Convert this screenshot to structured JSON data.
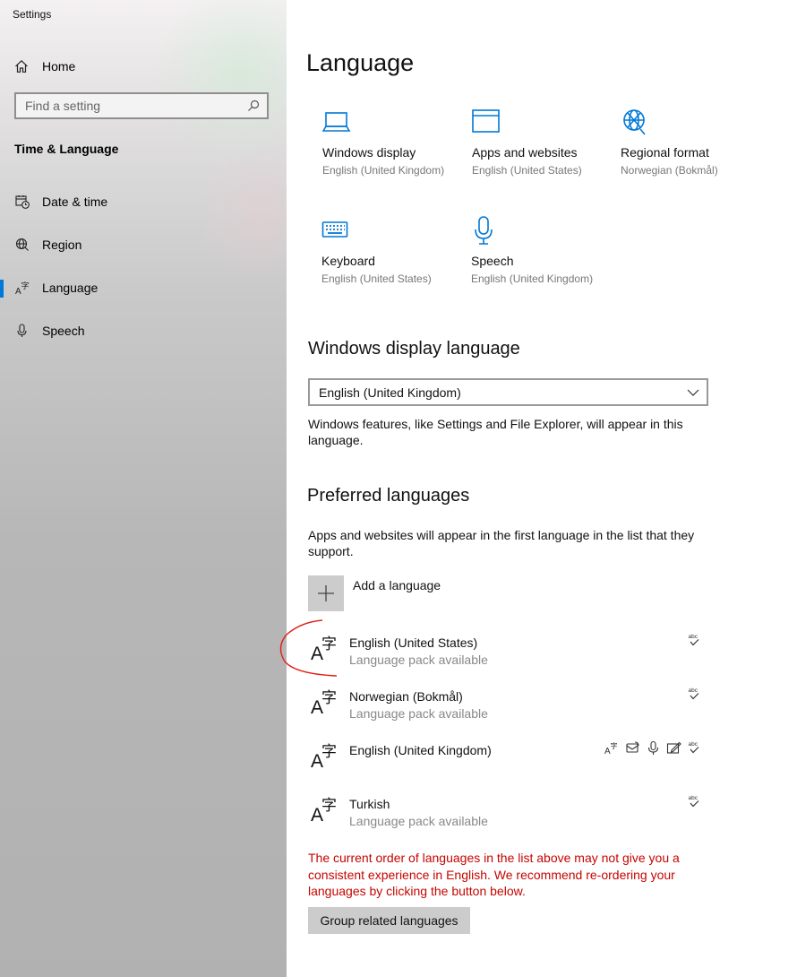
{
  "window": {
    "title": "Settings"
  },
  "sidebar": {
    "home_label": "Home",
    "search_placeholder": "Find a setting",
    "section_title": "Time & Language",
    "items": [
      {
        "label": "Date & time",
        "icon": "calendar-clock-icon",
        "active": false
      },
      {
        "label": "Region",
        "icon": "globe-region-icon",
        "active": false
      },
      {
        "label": "Language",
        "icon": "language-icon",
        "active": true
      },
      {
        "label": "Speech",
        "icon": "microphone-icon",
        "active": false
      }
    ],
    "accent_color": "#0078d7"
  },
  "main": {
    "title": "Language",
    "tiles": [
      {
        "name": "Windows display",
        "sub": "English (United Kingdom)",
        "icon": "laptop-icon"
      },
      {
        "name": "Apps and websites",
        "sub": "English (United States)",
        "icon": "browser-window-icon"
      },
      {
        "name": "Regional format",
        "sub": "Norwegian (Bokmål)",
        "icon": "globe-format-icon"
      },
      {
        "name": "Keyboard",
        "sub": "English (United States)",
        "icon": "keyboard-icon"
      },
      {
        "name": "Speech",
        "sub": "English (United Kingdom)",
        "icon": "microphone-icon"
      }
    ],
    "display_language": {
      "heading": "Windows display language",
      "selected": "English (United Kingdom)",
      "description": "Windows features, like Settings and File Explorer, will appear in this language."
    },
    "preferred": {
      "heading": "Preferred languages",
      "description": "Apps and websites will appear in the first language in the list that they support.",
      "add_label": "Add a language",
      "languages": [
        {
          "name": "English (United States)",
          "status": "Language pack available",
          "features": [
            "spellcheck-icon"
          ]
        },
        {
          "name": "Norwegian (Bokmål)",
          "status": "Language pack available",
          "features": [
            "spellcheck-icon"
          ]
        },
        {
          "name": "English (United Kingdom)",
          "status": "",
          "features": [
            "display-language-icon",
            "text-to-speech-icon",
            "speech-recognition-icon",
            "handwriting-icon",
            "spellcheck-icon"
          ]
        },
        {
          "name": "Turkish",
          "status": "Language pack available",
          "features": [
            "spellcheck-icon"
          ]
        }
      ],
      "warning": "The current order of languages in the list above may not give you a consistent experience in English. We recommend re-ordering your languages by clicking the button below.",
      "warning_color": "#c50500",
      "group_button_label": "Group related languages"
    }
  }
}
